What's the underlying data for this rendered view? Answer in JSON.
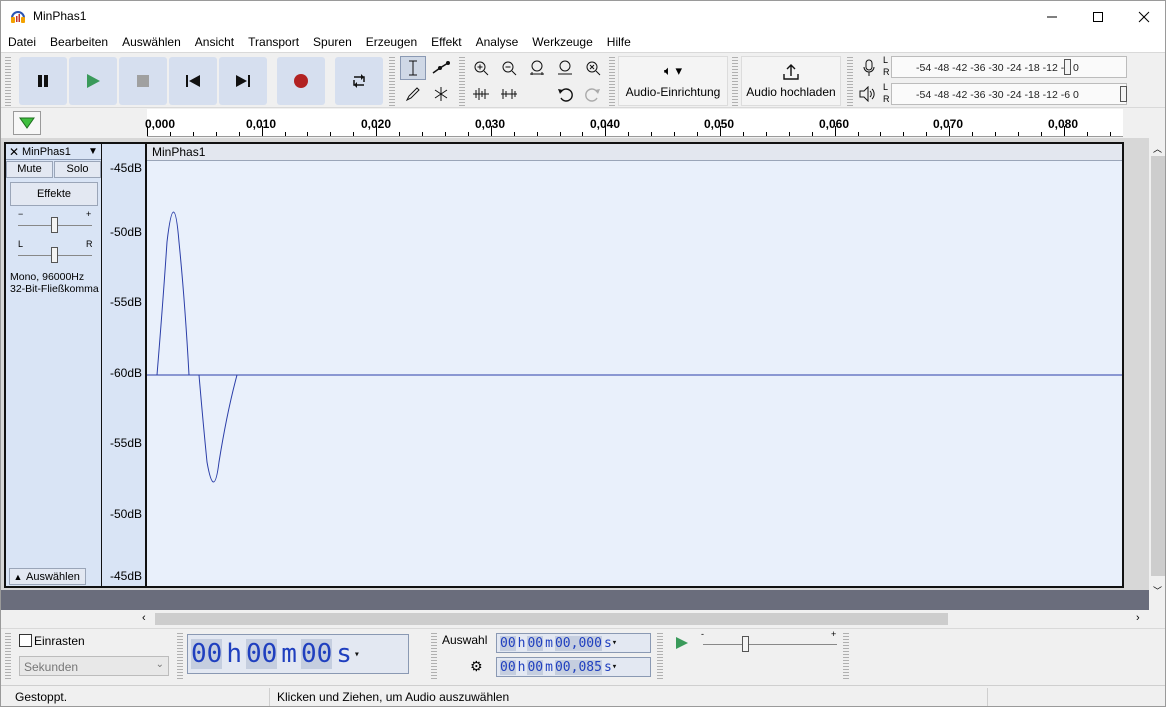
{
  "window": {
    "title": "MinPhas1",
    "minimize_icon": "minimize-icon",
    "maximize_icon": "maximize-icon",
    "close_icon": "close-icon"
  },
  "menu": [
    "Datei",
    "Bearbeiten",
    "Auswählen",
    "Ansicht",
    "Transport",
    "Spuren",
    "Erzeugen",
    "Effekt",
    "Analyse",
    "Werkzeuge",
    "Hilfe"
  ],
  "toolbar": {
    "transport_icons": [
      "pause-icon",
      "play-icon",
      "stop-icon",
      "skip-to-start-icon",
      "skip-to-end-icon",
      "record-icon",
      "loop-icon"
    ],
    "audio_setup_label": "Audio-Einrichtung",
    "audio_share_label": "Audio hochladen",
    "meter_scale": "-54  -48  -42  -36  -30  -24  -18  -12   -6    0",
    "meter_lr": {
      "l": "L",
      "r": "R"
    },
    "colors": {
      "button_bg": "#d6dfef",
      "play": "#3a9a5a",
      "record": "#b22222"
    }
  },
  "ruler": {
    "labels": [
      "0,000",
      "0,010",
      "0,020",
      "0,030",
      "0,040",
      "0,050",
      "0,060",
      "0,070",
      "0,080"
    ]
  },
  "track": {
    "name": "MinPhas1",
    "mute_label": "Mute",
    "solo_label": "Solo",
    "effects_label": "Effekte",
    "gain_minus": "−",
    "gain_plus": "+",
    "pan_left": "L",
    "pan_right": "R",
    "info_line1": "Mono, 96000Hz",
    "info_line2": "32-Bit-Fließkomma",
    "select_label": "Auswählen",
    "clip_title": "MinPhas1",
    "db_labels": [
      "-45dB",
      "-50dB",
      "-55dB",
      "-60dB",
      "-55dB",
      "-50dB",
      "-45dB"
    ],
    "wave_color": "#2b3ea8"
  },
  "bottom": {
    "snap_label": "Einrasten",
    "snap_unit": "Sekunden",
    "time_display": {
      "h": "00",
      "hu": "h",
      "m": "00",
      "mu": "m",
      "s": "00",
      "su": "s"
    },
    "selection_label": "Auswahl",
    "sel_start": {
      "h": "00",
      "hu": "h",
      "m": "00",
      "mu": "m",
      "s": "00,000",
      "su": "s"
    },
    "sel_end": {
      "h": "00",
      "hu": "h",
      "m": "00",
      "mu": "m",
      "s": "00,085",
      "su": "s"
    },
    "speed_minus": "-",
    "speed_plus": "+"
  },
  "status": {
    "state": "Gestoppt.",
    "hint": "Klicken und Ziehen, um Audio auszuwählen"
  }
}
